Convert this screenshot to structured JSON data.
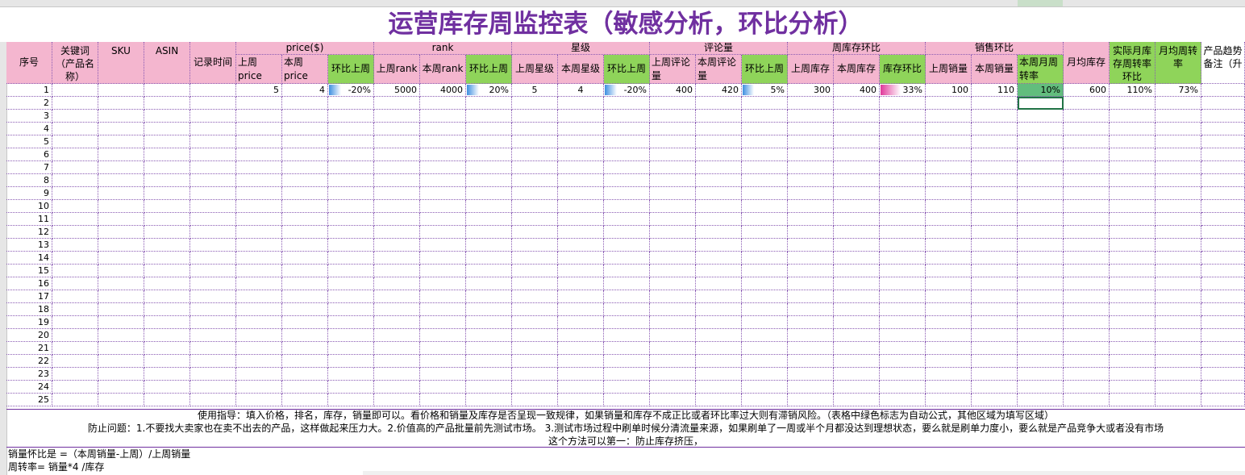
{
  "title": "运营库存周监控表（敏感分析，环比分析）",
  "colors": {
    "purple": "#7030a0",
    "pink": "#f4b6cf",
    "green": "#8fd45a",
    "selected": "#62bd7d"
  },
  "groups": {
    "price": "price($)",
    "rank": "rank",
    "stars": "星级",
    "reviews": "评论量",
    "inventory": "周库存环比",
    "sales": "销售环比"
  },
  "headers": {
    "seq": "序号",
    "keyword": "关键词（产品名称）",
    "sku": "SKU",
    "asin": "ASIN",
    "record_time": "记录时间",
    "prev_price": "上周 price",
    "cur_price": "本周 price",
    "price_mom": "环比上周",
    "prev_rank": "上周rank",
    "cur_rank": "本周rank",
    "rank_mom": "环比上周",
    "prev_star": "上周星级",
    "cur_star": "本周星级",
    "star_mom": "环比上周",
    "prev_review": "上周评论量",
    "cur_review": "本周评论量",
    "review_mom": "环比上周",
    "prev_inv": "上周库存",
    "cur_inv": "本周库存",
    "inv_mom": "库存环比",
    "prev_sales": "上周销量",
    "cur_sales": "本周销量",
    "turnover": "本周月周转率",
    "monthly_inv": "月均库存",
    "actual_turnover": "实际月库存周转率环比",
    "avg_turnover": "月均周转率",
    "trend_note": "产品趋势备注（升"
  },
  "row1": {
    "seq": "1",
    "prev_price": "5",
    "cur_price": "4",
    "price_mom": "-20%",
    "price_mom_value": -20,
    "prev_rank": "5000",
    "cur_rank": "4000",
    "rank_mom": "20%",
    "rank_mom_value": 20,
    "prev_star": "5",
    "cur_star": "4",
    "star_mom": "-20%",
    "star_mom_value": -20,
    "prev_review": "400",
    "cur_review": "420",
    "review_mom": "5%",
    "review_mom_value": 5,
    "prev_inv": "300",
    "cur_inv": "400",
    "inv_mom": "33%",
    "inv_mom_value": 33,
    "prev_sales": "100",
    "cur_sales": "110",
    "turnover": "10%",
    "monthly_inv": "600",
    "actual_turnover": "110%",
    "avg_turnover": "73%"
  },
  "row_numbers": [
    "1",
    "2",
    "3",
    "4",
    "5",
    "6",
    "7",
    "8",
    "9",
    "10",
    "11",
    "12",
    "13",
    "14",
    "15",
    "16",
    "17",
    "18",
    "19",
    "20",
    "21",
    "22",
    "23",
    "24",
    "25"
  ],
  "notes": {
    "guide": "使用指导：填入价格，排名，库存，销量即可以。看价格和销量及库存是否呈现一致规律，如果销量和库存不成正比或者环比率过大则有滞销风险。（表格中绿色标志为自动公式，其他区域为填写区域）",
    "problems": "防止问题：1.不要找大卖家也在卖不出去的产品，这样做起来压力大。2.价值高的产品批量前先测试市场。   3.测试市场过程中刷单时候分清流量来源，如果刷单了一周或半个月都没达到理想状态，要么就是刷单力度小，要么就是产品竞争大或者没有市场",
    "method": "这个方法可以第一：防止库存挤压，"
  },
  "footnotes": {
    "sales_mom": "销量怀比是 =（本周销量-上周）/上周销量",
    "turnover_formula": "周转率= 销量*4 /库存"
  }
}
